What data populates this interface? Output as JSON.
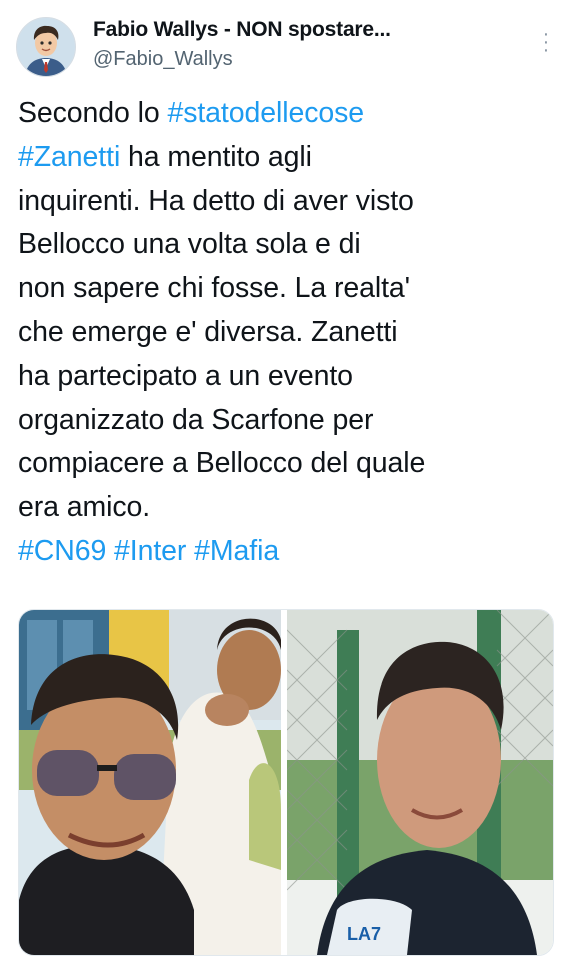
{
  "tweet": {
    "author": {
      "display_name": "Fabio Wallys - NON spostare...",
      "handle": "@Fabio_Wallys",
      "avatar_icon": "cartoon-avatar-icon"
    },
    "more_icon": "more-options-icon",
    "text_lines": [
      [
        {
          "t": "Secondo lo ",
          "tag": false
        },
        {
          "t": "#statodellecose",
          "tag": true
        }
      ],
      [
        {
          "t": "#Zanetti",
          "tag": true
        },
        {
          "t": " ha mentito agli",
          "tag": false
        }
      ],
      [
        {
          "t": "inquirenti.  Ha detto di aver visto",
          "tag": false
        }
      ],
      [
        {
          "t": "Bellocco una volta sola e di",
          "tag": false
        }
      ],
      [
        {
          "t": "non sapere chi fosse. La realta'",
          "tag": false
        }
      ],
      [
        {
          "t": "che emerge e' diversa. Zanetti",
          "tag": false
        }
      ],
      [
        {
          "t": "ha partecipato a un evento",
          "tag": false
        }
      ],
      [
        {
          "t": "organizzato da Scarfone per",
          "tag": false
        }
      ],
      [
        {
          "t": "compiacere a Bellocco del quale",
          "tag": false
        }
      ],
      [
        {
          "t": "era amico.",
          "tag": false
        }
      ],
      [
        {
          "t": "#CN69",
          "tag": true
        },
        {
          "t": " ",
          "tag": false
        },
        {
          "t": "#Inter",
          "tag": true
        },
        {
          "t": " ",
          "tag": false
        },
        {
          "t": "#Mafia",
          "tag": true
        }
      ]
    ],
    "media": {
      "left_photo": "two men selfie outdoors with sunglasses",
      "right_photo": "man interviewed in front of green fence",
      "right_mic_logo": "LA7"
    },
    "colors": {
      "link": "#1d9bf0",
      "text": "#0f1419",
      "secondary": "#536471"
    }
  }
}
